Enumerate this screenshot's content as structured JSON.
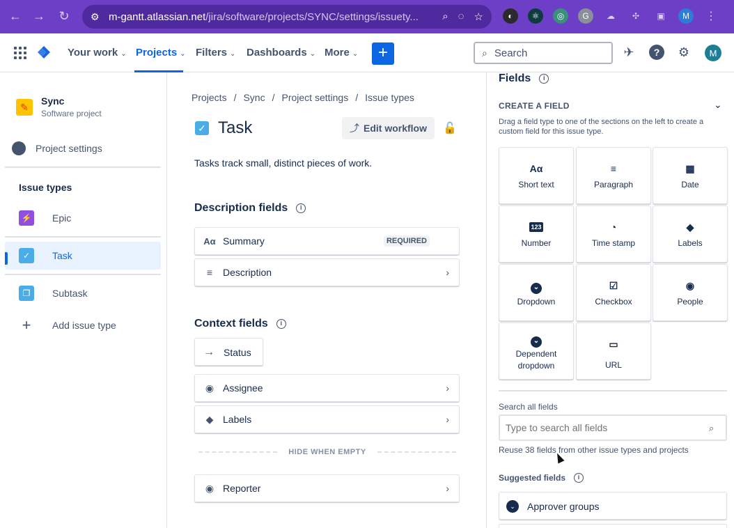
{
  "browser": {
    "url_host": "m-gantt.atlassian.net",
    "url_path": "/jira/software/projects/SYNC/settings/issuety...",
    "profile_initial": "M",
    "colors": {
      "frame": "#6D3FC6",
      "urlbar": "#4F2A9E"
    }
  },
  "topnav": {
    "items": [
      {
        "label": "Your work"
      },
      {
        "label": "Projects"
      },
      {
        "label": "Filters"
      },
      {
        "label": "Dashboards"
      },
      {
        "label": "More"
      }
    ],
    "active": "Projects",
    "search_label": "Search",
    "avatar_initial": "M",
    "accent": "#0C66E4"
  },
  "sidebar": {
    "project_name": "Sync",
    "project_type": "Software project",
    "back_label": "Project settings",
    "heading": "Issue types",
    "items": [
      {
        "label": "Epic",
        "icon": "lightning-icon",
        "color": "#904EE2"
      },
      {
        "label": "Task",
        "icon": "check-icon",
        "color": "#4BADE8"
      },
      {
        "label": "Subtask",
        "icon": "subtask-icon",
        "color": "#4BADE8"
      },
      {
        "label": "Add issue type",
        "icon": "plus-icon"
      }
    ],
    "selected": "Task"
  },
  "main": {
    "breadcrumbs": [
      "Projects",
      "Sync",
      "Project settings",
      "Issue types"
    ],
    "title": "Task",
    "edit_workflow": "Edit workflow",
    "description": "Tasks track small, distinct pieces of work.",
    "description_fields_title": "Description fields",
    "description_fields": [
      {
        "label": "Summary",
        "badge": "REQUIRED"
      },
      {
        "label": "Description"
      }
    ],
    "context_fields_title": "Context fields",
    "status_label": "Status",
    "context_fields": [
      {
        "label": "Assignee"
      },
      {
        "label": "Labels"
      }
    ],
    "hide_when_empty": "HIDE WHEN EMPTY",
    "hidden_fields": [
      {
        "label": "Reporter"
      }
    ]
  },
  "panel": {
    "title": "Fields",
    "create_heading": "CREATE A FIELD",
    "create_help": "Drag a field type to one of the sections on the left to create a custom field for this issue type.",
    "field_types": [
      {
        "label": "Short text",
        "icon": "text-icon",
        "glyph": "Aα"
      },
      {
        "label": "Paragraph",
        "icon": "paragraph-icon",
        "glyph": "≡"
      },
      {
        "label": "Date",
        "icon": "calendar-icon",
        "glyph": "▦"
      },
      {
        "label": "Number",
        "icon": "number-icon",
        "glyph": "123"
      },
      {
        "label": "Time stamp",
        "icon": "clock-icon",
        "glyph": "◔"
      },
      {
        "label": "Labels",
        "icon": "tag-icon",
        "glyph": "◆"
      },
      {
        "label": "Dropdown",
        "icon": "dropdown-icon",
        "glyph": "⌄"
      },
      {
        "label": "Checkbox",
        "icon": "checkbox-icon",
        "glyph": "☑"
      },
      {
        "label": "People",
        "icon": "person-icon",
        "glyph": "◉"
      },
      {
        "label": "Dependent dropdown",
        "icon": "dependent-dropdown-icon",
        "glyph": "⌄"
      },
      {
        "label": "URL",
        "icon": "link-icon",
        "glyph": "▭"
      }
    ],
    "search_label": "Search all fields",
    "search_placeholder": "Type to search all fields",
    "reuse_text": "Reuse 38 fields from other issue types and projects",
    "suggested_title": "Suggested fields",
    "suggested": [
      {
        "label": "Approver groups"
      }
    ]
  }
}
